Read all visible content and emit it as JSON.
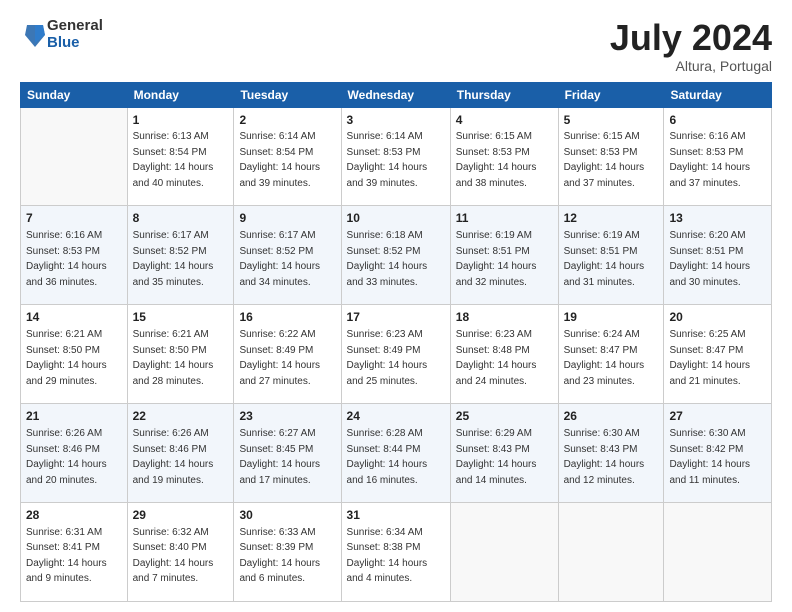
{
  "logo": {
    "general": "General",
    "blue": "Blue"
  },
  "title": "July 2024",
  "location": "Altura, Portugal",
  "header_days": [
    "Sunday",
    "Monday",
    "Tuesday",
    "Wednesday",
    "Thursday",
    "Friday",
    "Saturday"
  ],
  "weeks": [
    [
      {
        "day": "",
        "sunrise": "",
        "sunset": "",
        "daylight": ""
      },
      {
        "day": "1",
        "sunrise": "Sunrise: 6:13 AM",
        "sunset": "Sunset: 8:54 PM",
        "daylight": "Daylight: 14 hours and 40 minutes."
      },
      {
        "day": "2",
        "sunrise": "Sunrise: 6:14 AM",
        "sunset": "Sunset: 8:54 PM",
        "daylight": "Daylight: 14 hours and 39 minutes."
      },
      {
        "day": "3",
        "sunrise": "Sunrise: 6:14 AM",
        "sunset": "Sunset: 8:53 PM",
        "daylight": "Daylight: 14 hours and 39 minutes."
      },
      {
        "day": "4",
        "sunrise": "Sunrise: 6:15 AM",
        "sunset": "Sunset: 8:53 PM",
        "daylight": "Daylight: 14 hours and 38 minutes."
      },
      {
        "day": "5",
        "sunrise": "Sunrise: 6:15 AM",
        "sunset": "Sunset: 8:53 PM",
        "daylight": "Daylight: 14 hours and 37 minutes."
      },
      {
        "day": "6",
        "sunrise": "Sunrise: 6:16 AM",
        "sunset": "Sunset: 8:53 PM",
        "daylight": "Daylight: 14 hours and 37 minutes."
      }
    ],
    [
      {
        "day": "7",
        "sunrise": "Sunrise: 6:16 AM",
        "sunset": "Sunset: 8:53 PM",
        "daylight": "Daylight: 14 hours and 36 minutes."
      },
      {
        "day": "8",
        "sunrise": "Sunrise: 6:17 AM",
        "sunset": "Sunset: 8:52 PM",
        "daylight": "Daylight: 14 hours and 35 minutes."
      },
      {
        "day": "9",
        "sunrise": "Sunrise: 6:17 AM",
        "sunset": "Sunset: 8:52 PM",
        "daylight": "Daylight: 14 hours and 34 minutes."
      },
      {
        "day": "10",
        "sunrise": "Sunrise: 6:18 AM",
        "sunset": "Sunset: 8:52 PM",
        "daylight": "Daylight: 14 hours and 33 minutes."
      },
      {
        "day": "11",
        "sunrise": "Sunrise: 6:19 AM",
        "sunset": "Sunset: 8:51 PM",
        "daylight": "Daylight: 14 hours and 32 minutes."
      },
      {
        "day": "12",
        "sunrise": "Sunrise: 6:19 AM",
        "sunset": "Sunset: 8:51 PM",
        "daylight": "Daylight: 14 hours and 31 minutes."
      },
      {
        "day": "13",
        "sunrise": "Sunrise: 6:20 AM",
        "sunset": "Sunset: 8:51 PM",
        "daylight": "Daylight: 14 hours and 30 minutes."
      }
    ],
    [
      {
        "day": "14",
        "sunrise": "Sunrise: 6:21 AM",
        "sunset": "Sunset: 8:50 PM",
        "daylight": "Daylight: 14 hours and 29 minutes."
      },
      {
        "day": "15",
        "sunrise": "Sunrise: 6:21 AM",
        "sunset": "Sunset: 8:50 PM",
        "daylight": "Daylight: 14 hours and 28 minutes."
      },
      {
        "day": "16",
        "sunrise": "Sunrise: 6:22 AM",
        "sunset": "Sunset: 8:49 PM",
        "daylight": "Daylight: 14 hours and 27 minutes."
      },
      {
        "day": "17",
        "sunrise": "Sunrise: 6:23 AM",
        "sunset": "Sunset: 8:49 PM",
        "daylight": "Daylight: 14 hours and 25 minutes."
      },
      {
        "day": "18",
        "sunrise": "Sunrise: 6:23 AM",
        "sunset": "Sunset: 8:48 PM",
        "daylight": "Daylight: 14 hours and 24 minutes."
      },
      {
        "day": "19",
        "sunrise": "Sunrise: 6:24 AM",
        "sunset": "Sunset: 8:47 PM",
        "daylight": "Daylight: 14 hours and 23 minutes."
      },
      {
        "day": "20",
        "sunrise": "Sunrise: 6:25 AM",
        "sunset": "Sunset: 8:47 PM",
        "daylight": "Daylight: 14 hours and 21 minutes."
      }
    ],
    [
      {
        "day": "21",
        "sunrise": "Sunrise: 6:26 AM",
        "sunset": "Sunset: 8:46 PM",
        "daylight": "Daylight: 14 hours and 20 minutes."
      },
      {
        "day": "22",
        "sunrise": "Sunrise: 6:26 AM",
        "sunset": "Sunset: 8:46 PM",
        "daylight": "Daylight: 14 hours and 19 minutes."
      },
      {
        "day": "23",
        "sunrise": "Sunrise: 6:27 AM",
        "sunset": "Sunset: 8:45 PM",
        "daylight": "Daylight: 14 hours and 17 minutes."
      },
      {
        "day": "24",
        "sunrise": "Sunrise: 6:28 AM",
        "sunset": "Sunset: 8:44 PM",
        "daylight": "Daylight: 14 hours and 16 minutes."
      },
      {
        "day": "25",
        "sunrise": "Sunrise: 6:29 AM",
        "sunset": "Sunset: 8:43 PM",
        "daylight": "Daylight: 14 hours and 14 minutes."
      },
      {
        "day": "26",
        "sunrise": "Sunrise: 6:30 AM",
        "sunset": "Sunset: 8:43 PM",
        "daylight": "Daylight: 14 hours and 12 minutes."
      },
      {
        "day": "27",
        "sunrise": "Sunrise: 6:30 AM",
        "sunset": "Sunset: 8:42 PM",
        "daylight": "Daylight: 14 hours and 11 minutes."
      }
    ],
    [
      {
        "day": "28",
        "sunrise": "Sunrise: 6:31 AM",
        "sunset": "Sunset: 8:41 PM",
        "daylight": "Daylight: 14 hours and 9 minutes."
      },
      {
        "day": "29",
        "sunrise": "Sunrise: 6:32 AM",
        "sunset": "Sunset: 8:40 PM",
        "daylight": "Daylight: 14 hours and 7 minutes."
      },
      {
        "day": "30",
        "sunrise": "Sunrise: 6:33 AM",
        "sunset": "Sunset: 8:39 PM",
        "daylight": "Daylight: 14 hours and 6 minutes."
      },
      {
        "day": "31",
        "sunrise": "Sunrise: 6:34 AM",
        "sunset": "Sunset: 8:38 PM",
        "daylight": "Daylight: 14 hours and 4 minutes."
      },
      {
        "day": "",
        "sunrise": "",
        "sunset": "",
        "daylight": ""
      },
      {
        "day": "",
        "sunrise": "",
        "sunset": "",
        "daylight": ""
      },
      {
        "day": "",
        "sunrise": "",
        "sunset": "",
        "daylight": ""
      }
    ]
  ]
}
